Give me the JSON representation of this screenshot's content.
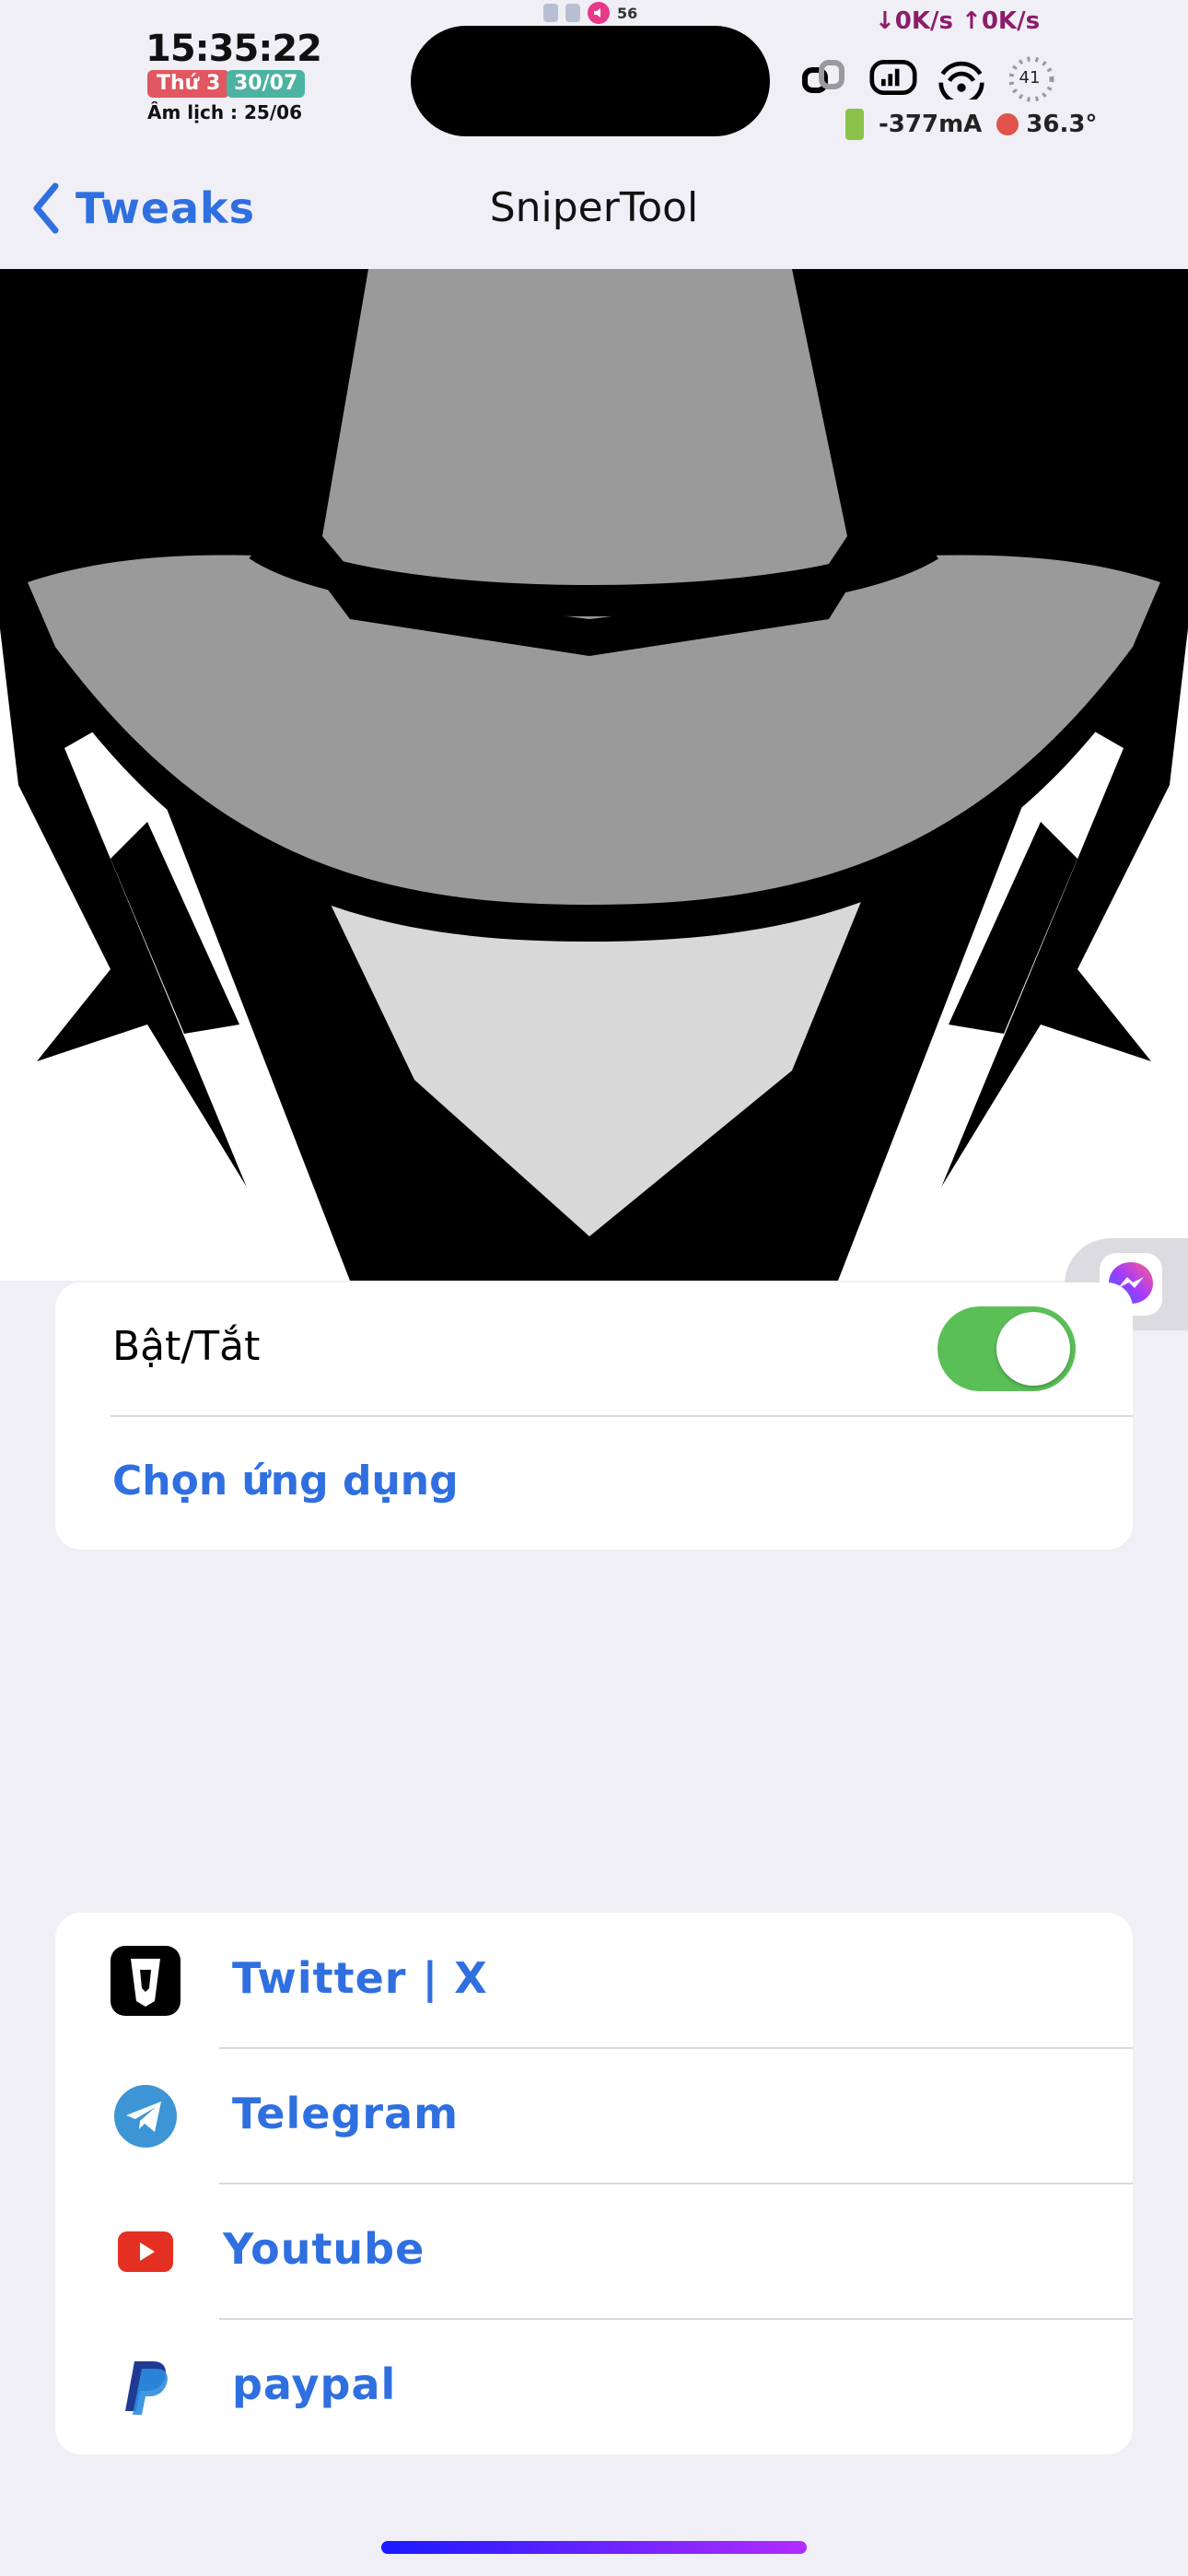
{
  "status_bar": {
    "time": "15:35:22",
    "weekday": "Thứ 3",
    "date": "30/07",
    "lunar": "Âm lịch : 25/06",
    "volume": "56",
    "network_speed": "↓0K/s ↑0K/s",
    "ring_value": "41",
    "battery_current": "-377mA",
    "temperature": "36.3°"
  },
  "nav": {
    "back_label": "Tweaks",
    "title": "SniperTool"
  },
  "settings": {
    "toggle_label": "Bật/Tắt",
    "toggle_on": true,
    "choose_app_label": "Chọn ứng dụng"
  },
  "social": {
    "items": [
      {
        "label": "Twitter | X",
        "icon": "twitter-x-icon"
      },
      {
        "label": "Telegram",
        "icon": "telegram-icon"
      },
      {
        "label": "Youtube",
        "icon": "youtube-icon"
      },
      {
        "label": "paypal",
        "icon": "paypal-icon"
      }
    ]
  },
  "colors": {
    "accent": "#2f6fe0",
    "toggle_on": "#5bbf58",
    "background": "#f0eff5"
  }
}
